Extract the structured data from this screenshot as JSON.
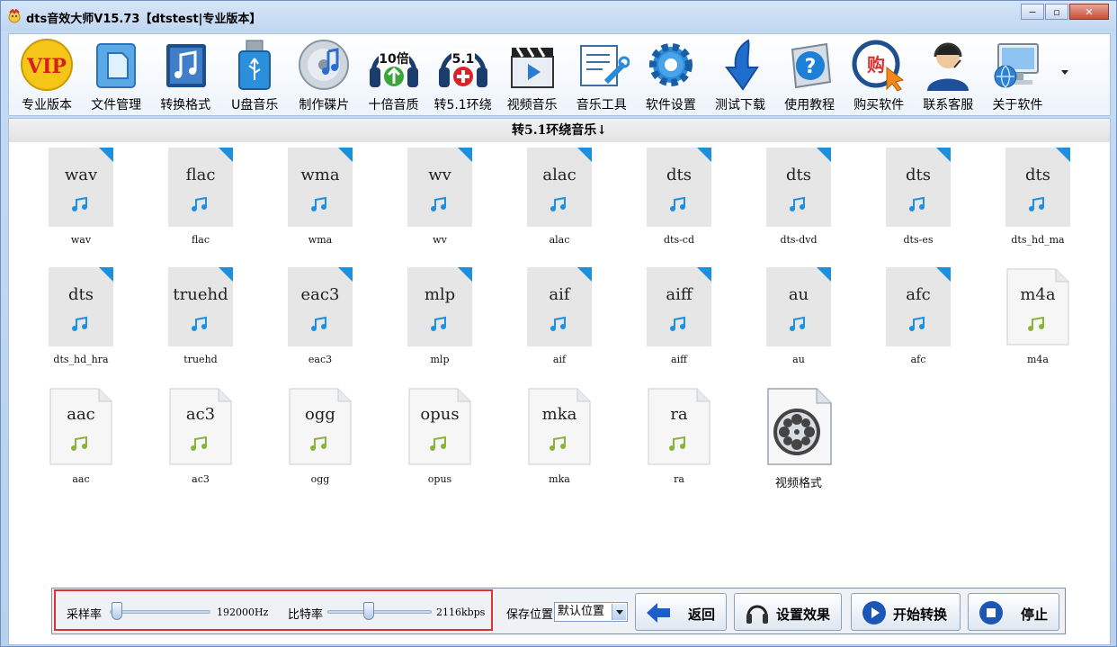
{
  "window": {
    "title": "dts音效大师V15.73【dtstest|专业版本】",
    "controls": {
      "minimize": "−",
      "maximize": "▫",
      "close": "✕"
    }
  },
  "toolbar": {
    "items": [
      {
        "label": "专业版本",
        "icon": "vip-icon"
      },
      {
        "label": "文件管理",
        "icon": "file-manager-icon"
      },
      {
        "label": "转换格式",
        "icon": "music-note-icon"
      },
      {
        "label": "U盘音乐",
        "icon": "usb-drive-icon"
      },
      {
        "label": "制作碟片",
        "icon": "disc-icon"
      },
      {
        "label": "十倍音质",
        "icon": "headphones-10x-icon",
        "badge": "10倍"
      },
      {
        "label": "转5.1环绕",
        "icon": "headphones-51-icon",
        "badge": "5.1"
      },
      {
        "label": "视频音乐",
        "icon": "clapperboard-icon"
      },
      {
        "label": "音乐工具",
        "icon": "tools-icon"
      },
      {
        "label": "软件设置",
        "icon": "gear-icon"
      },
      {
        "label": "测试下载",
        "icon": "download-arrow-icon"
      },
      {
        "label": "使用教程",
        "icon": "help-icon"
      },
      {
        "label": "购买软件",
        "icon": "buy-cursor-icon",
        "badge": "购"
      },
      {
        "label": "联系客服",
        "icon": "support-agent-icon"
      },
      {
        "label": "关于软件",
        "icon": "computer-globe-icon"
      }
    ]
  },
  "section": {
    "title": "转5.1环绕音乐",
    "arrow": "↓"
  },
  "files": [
    {
      "ext": "wav",
      "caption": "wav",
      "style": "gray"
    },
    {
      "ext": "flac",
      "caption": "flac",
      "style": "gray"
    },
    {
      "ext": "wma",
      "caption": "wma",
      "style": "gray"
    },
    {
      "ext": "wv",
      "caption": "wv",
      "style": "gray"
    },
    {
      "ext": "alac",
      "caption": "alac",
      "style": "gray"
    },
    {
      "ext": "dts",
      "caption": "dts-cd",
      "style": "gray"
    },
    {
      "ext": "dts",
      "caption": "dts-dvd",
      "style": "gray"
    },
    {
      "ext": "dts",
      "caption": "dts-es",
      "style": "gray"
    },
    {
      "ext": "dts",
      "caption": "dts_hd_ma",
      "style": "gray"
    },
    {
      "ext": "dts",
      "caption": "dts_hd_hra",
      "style": "gray"
    },
    {
      "ext": "truehd",
      "caption": "truehd",
      "style": "gray"
    },
    {
      "ext": "eac3",
      "caption": "eac3",
      "style": "gray"
    },
    {
      "ext": "mlp",
      "caption": "mlp",
      "style": "gray"
    },
    {
      "ext": "aif",
      "caption": "aif",
      "style": "gray"
    },
    {
      "ext": "aiff",
      "caption": "aiff",
      "style": "gray"
    },
    {
      "ext": "au",
      "caption": "au",
      "style": "gray"
    },
    {
      "ext": "afc",
      "caption": "afc",
      "style": "gray"
    },
    {
      "ext": "m4a",
      "caption": "m4a",
      "style": "light"
    },
    {
      "ext": "aac",
      "caption": "aac",
      "style": "light"
    },
    {
      "ext": "ac3",
      "caption": "ac3",
      "style": "light"
    },
    {
      "ext": "ogg",
      "caption": "ogg",
      "style": "light"
    },
    {
      "ext": "opus",
      "caption": "opus",
      "style": "light"
    },
    {
      "ext": "mka",
      "caption": "mka",
      "style": "light"
    },
    {
      "ext": "ra",
      "caption": "ra",
      "style": "light"
    },
    {
      "ext": "",
      "caption": "视频格式",
      "style": "video"
    }
  ],
  "bottom": {
    "sample_rate": {
      "label": "采样率",
      "value": "192000Hz",
      "level": 0.02
    },
    "bit_rate": {
      "label": "比特率",
      "value": "2116kbps",
      "level": 0.38
    },
    "save_location": {
      "label": "保存位置",
      "selected": "默认位置"
    },
    "buttons": {
      "back": "返回",
      "effects": "设置效果",
      "start": "开始转换",
      "stop": "停止"
    }
  },
  "colors": {
    "note_blue": "#1e90e0",
    "note_green": "#8ab33a",
    "corner_blue": "#1e8fdc",
    "highlight_red": "#e03232"
  }
}
